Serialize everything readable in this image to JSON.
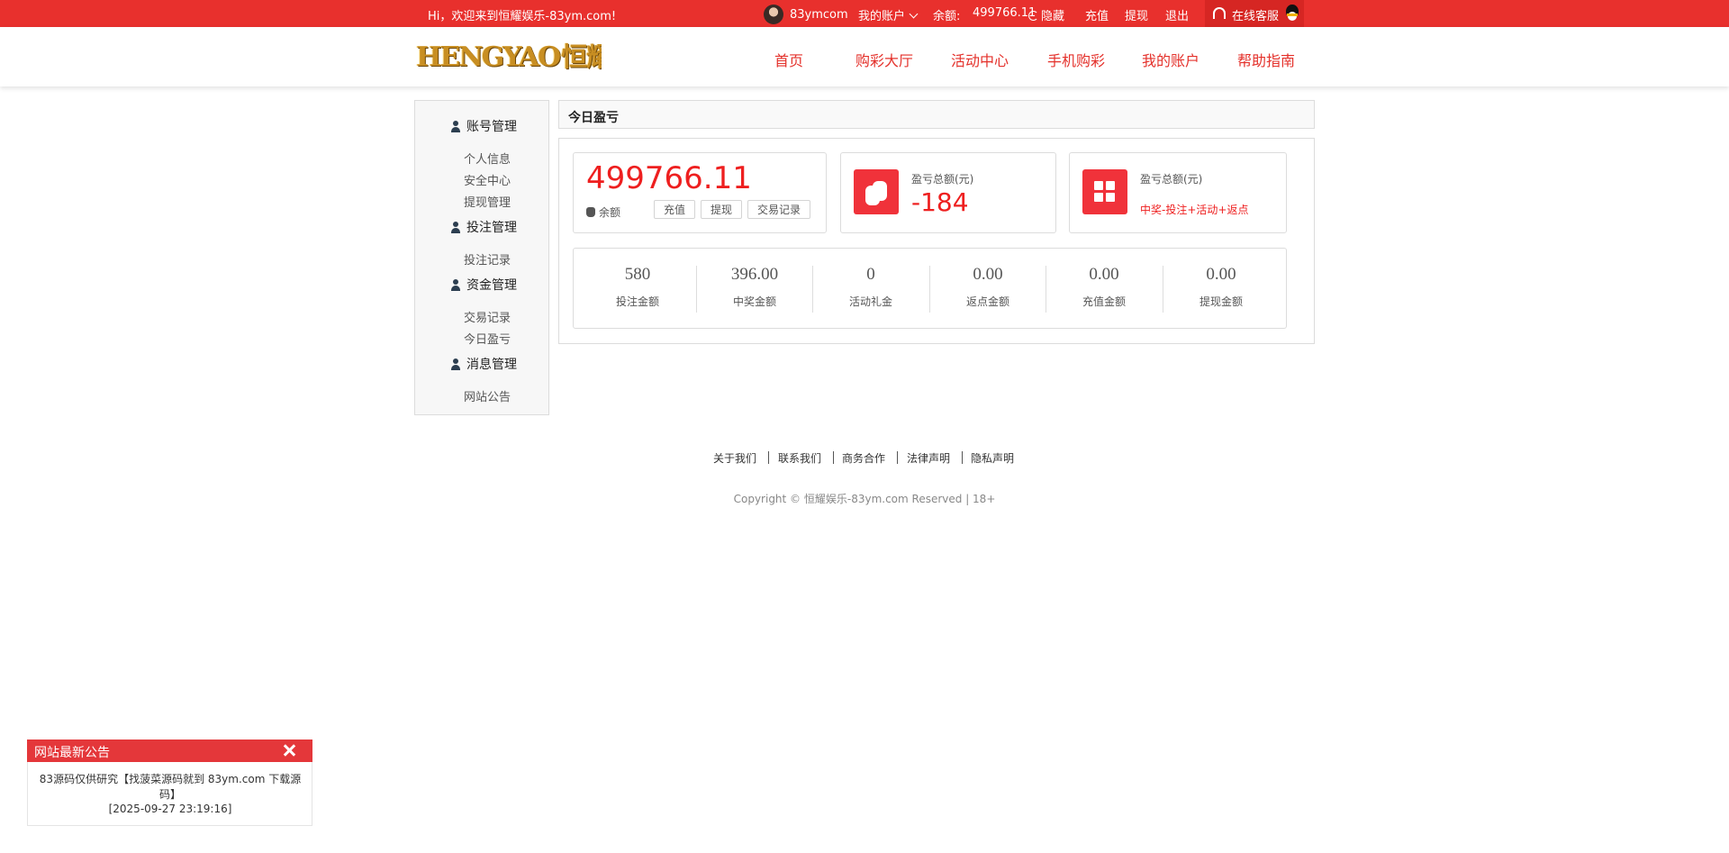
{
  "topbar": {
    "welcome": "Hi，欢迎来到恒耀娱乐-83ym.com!",
    "username": "83ymcom",
    "my_account": "我的账户",
    "balance_label": "余额:",
    "balance_value": "499766.11",
    "hide_label": "隐藏",
    "recharge": "充值",
    "withdraw": "提现",
    "logout": "退出",
    "service": "在线客服"
  },
  "header": {
    "logo_en": "HENGYAO",
    "logo_cn": "恒耀",
    "nav": [
      "首页",
      "购彩大厅",
      "活动中心",
      "手机购彩",
      "我的账户",
      "帮助指南"
    ]
  },
  "sidebar": {
    "sections": [
      {
        "title": "账号管理",
        "items": [
          "个人信息",
          "安全中心",
          "提现管理"
        ]
      },
      {
        "title": "投注管理",
        "items": [
          "投注记录"
        ]
      },
      {
        "title": "资金管理",
        "items": [
          "交易记录",
          "今日盈亏"
        ]
      },
      {
        "title": "消息管理",
        "items": [
          "网站公告"
        ]
      }
    ]
  },
  "main": {
    "panel_title": "今日盈亏",
    "balance": {
      "value": "499766.11",
      "label": "余额",
      "buttons": [
        "充值",
        "提现",
        "交易记录"
      ]
    },
    "profit_card": {
      "label": "盈亏总额(元)",
      "value": "-184"
    },
    "formula_card": {
      "label": "盈亏总额(元)",
      "formula": "中奖-投注+活动+返点"
    },
    "stats": [
      {
        "value": "580",
        "label": "投注金额"
      },
      {
        "value": "396.00",
        "label": "中奖金额"
      },
      {
        "value": "0",
        "label": "活动礼金"
      },
      {
        "value": "0.00",
        "label": "返点金额"
      },
      {
        "value": "0.00",
        "label": "充值金额"
      },
      {
        "value": "0.00",
        "label": "提现金额"
      }
    ]
  },
  "footer": {
    "links": [
      "关于我们",
      "联系我们",
      "商务合作",
      "法律声明",
      "隐私声明"
    ],
    "copyright": "Copyright © 恒耀娱乐-83ym.com Reserved | 18+"
  },
  "notice": {
    "title": "网站最新公告",
    "text": "83源码仅供研究【找菠菜源码就到 83ym.com 下载源码】",
    "date": "[2025-09-27 23:19:16]"
  },
  "colors": {
    "brand_red": "#e8302d",
    "value_red": "#ee1f1f"
  },
  "icons": [
    "avatar",
    "chevron-down-icon",
    "refresh-icon",
    "headset-icon",
    "qq-penguin-icon",
    "user-icon",
    "money-bag-icon",
    "coins-icon",
    "grid-icon",
    "close-icon"
  ]
}
